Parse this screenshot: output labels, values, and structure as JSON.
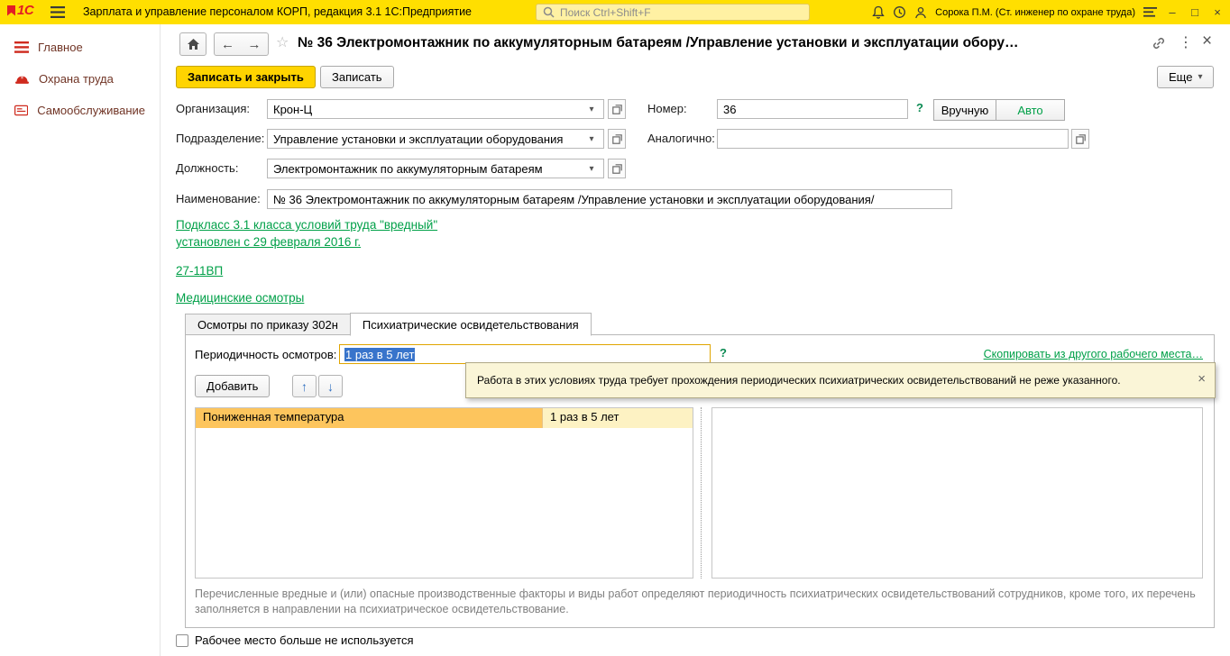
{
  "titlebar": {
    "app_title": "Зарплата и управление персоналом КОРП, редакция 3.1 1С:Предприятие",
    "search_placeholder": "Поиск Ctrl+Shift+F",
    "user": "Сорока П.М. (Ст. инженер по охране труда)",
    "logo": "1С"
  },
  "sidebar": {
    "items": [
      {
        "label": "Главное"
      },
      {
        "label": "Охрана труда"
      },
      {
        "label": "Самообслуживание"
      }
    ]
  },
  "header": {
    "title": "№ 36 Электромонтажник по аккумуляторным батареям /Управление установки и эксплуатации обору…"
  },
  "toolbar": {
    "save_close_label": "Записать и закрыть",
    "save_label": "Записать",
    "more_label": "Еще"
  },
  "form": {
    "organization": {
      "label": "Организация:",
      "value": "Крон-Ц"
    },
    "number": {
      "label": "Номер:",
      "value": "36",
      "manual_label": "Вручную",
      "auto_label": "Авто"
    },
    "department": {
      "label": "Подразделение:",
      "value": "Управление установки и эксплуатации оборудования"
    },
    "similar": {
      "label": "Аналогично:",
      "value": ""
    },
    "position": {
      "label": "Должность:",
      "value": "Электромонтажник по аккумуляторным батареям"
    },
    "name": {
      "label": "Наименование:",
      "value": "№ 36 Электромонтажник по аккумуляторным батареям /Управление установки и эксплуатации оборудования/"
    }
  },
  "links": {
    "subclass_line1": "Подкласс 3.1 класса условий труда \"вредный\"",
    "subclass_line2": "установлен с 29 февраля 2016 г.",
    "code": "27-11ВП",
    "medical": "Медицинские осмотры"
  },
  "tabs": [
    {
      "label": "Осмотры по приказу 302н"
    },
    {
      "label": "Психиатрические освидетельствования"
    }
  ],
  "psychiatric_tab": {
    "period_label": "Периодичность осмотров:",
    "period_value": "1 раз в 5 лет",
    "copy_link": "Скопировать из другого рабочего места…",
    "add_label": "Добавить",
    "hint": "Работа в этих условиях труда требует прохождения периодических психиатрических освидетельствований не реже указанного.",
    "factors": [
      {
        "name": "Пониженная температура",
        "period": "1 раз в 5 лет"
      }
    ],
    "footnote": "Перечисленные вредные и (или) опасные производственные факторы и виды работ определяют периодичность психиатрических освидетельствований сотрудников, кроме того, их перечень заполняется в направлении на психиатрическое освидетельствование."
  },
  "footer": {
    "checkbox_label": "Рабочее место больше не используется"
  },
  "icons": {
    "dropdown": "▾",
    "up_arrow": "↑",
    "down_arrow": "↓",
    "close": "×",
    "more_dots": "⋮",
    "star": "☆",
    "help": "?",
    "minimize": "–",
    "maximize": "□",
    "back": "←",
    "forward": "→"
  },
  "colors": {
    "topbar": "#ffdf00",
    "primary_button": "#ffd400",
    "link": "#00a048",
    "selection": "#3874cb",
    "row_highlight": "#fdc55d",
    "hint_bg": "#faf5d7",
    "sidebar_icon": "#cf2a1e"
  }
}
